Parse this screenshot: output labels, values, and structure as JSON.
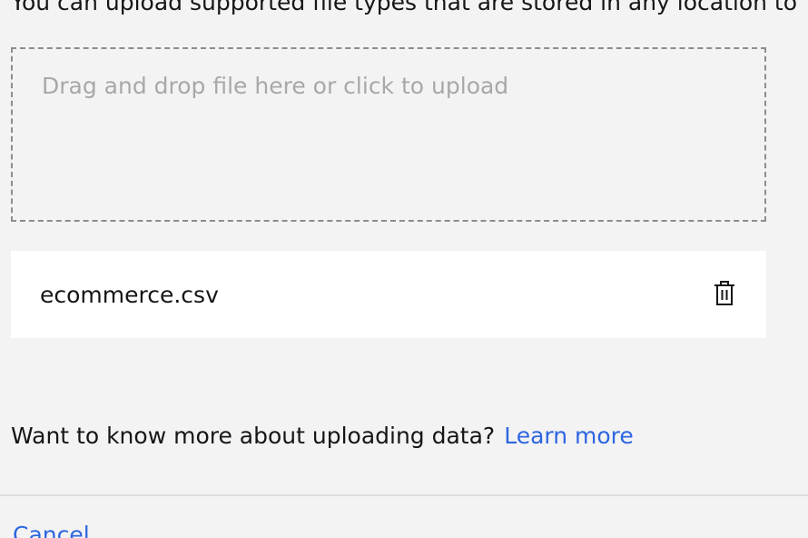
{
  "intro": {
    "text": "You can upload supported file types that are stored in any location to"
  },
  "dropzone": {
    "label": "Drag and drop file here or click to upload"
  },
  "file": {
    "name": "ecommerce.csv",
    "delete_icon": "trash-icon"
  },
  "info": {
    "text": "Want to know more about uploading data?",
    "link_label": "Learn more"
  },
  "footer": {
    "cancel_label": "Cancel"
  },
  "colors": {
    "link": "#2e66e0",
    "background": "#f3f3f3",
    "file_row": "#ffffff",
    "placeholder": "#a8a8a8"
  }
}
